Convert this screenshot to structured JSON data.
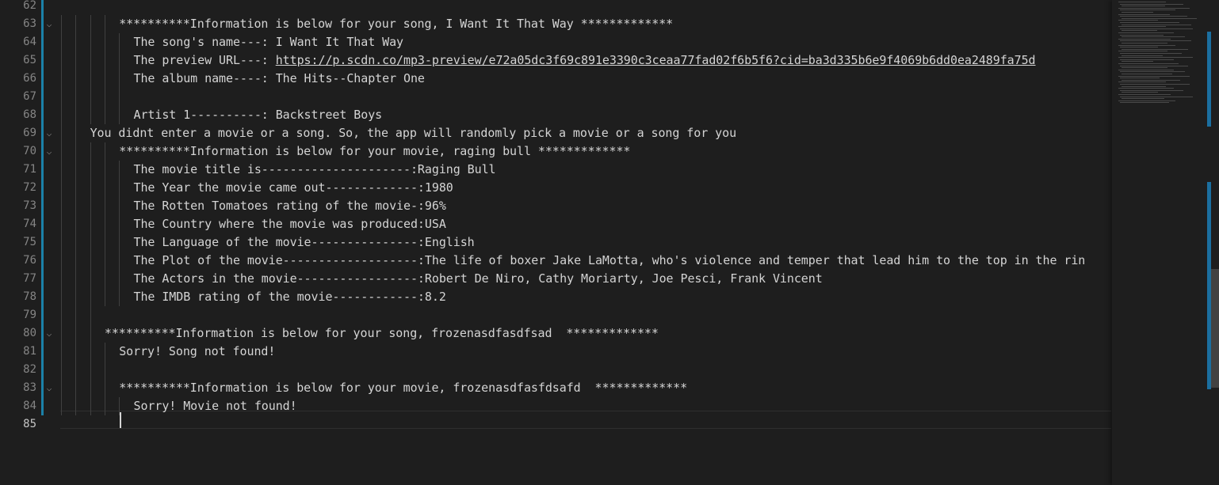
{
  "editor": {
    "lines": [
      {
        "num": "62",
        "text": "",
        "indent": 0,
        "fold": false,
        "modified": true
      },
      {
        "num": "63",
        "text": "**********Information is below for your song, I Want It That Way *************",
        "indent": 4,
        "fold": true,
        "modified": true
      },
      {
        "num": "64",
        "text": "The song's name---: I Want It That Way",
        "indent": 5,
        "fold": false,
        "modified": true
      },
      {
        "num": "65",
        "text": "The preview URL---: ",
        "link": "https://p.scdn.co/mp3-preview/e72a05dc3f69c891e3390c3ceaa77fad02f6b5f6?cid=ba3d335b6e9f4069b6dd0ea2489fa75d",
        "indent": 5,
        "fold": false,
        "modified": true
      },
      {
        "num": "66",
        "text": "The album name----: The Hits--Chapter One",
        "indent": 5,
        "fold": false,
        "modified": true
      },
      {
        "num": "67",
        "text": "",
        "indent": 0,
        "fold": false,
        "modified": true
      },
      {
        "num": "68",
        "text": "Artist 1----------: Backstreet Boys",
        "indent": 5,
        "fold": false,
        "modified": true
      },
      {
        "num": "69",
        "text": "You didnt enter a movie or a song. So, the app will randomly pick a movie or a song for you",
        "indent": 2,
        "fold": true,
        "modified": true
      },
      {
        "num": "70",
        "text": "**********Information is below for your movie, raging bull *************",
        "indent": 4,
        "fold": true,
        "modified": true
      },
      {
        "num": "71",
        "text": "The movie title is---------------------:Raging Bull",
        "indent": 5,
        "fold": false,
        "modified": true
      },
      {
        "num": "72",
        "text": "The Year the movie came out-------------:1980",
        "indent": 5,
        "fold": false,
        "modified": true
      },
      {
        "num": "73",
        "text": "The Rotten Tomatoes rating of the movie-:96%",
        "indent": 5,
        "fold": false,
        "modified": true
      },
      {
        "num": "74",
        "text": "The Country where the movie was produced:USA",
        "indent": 5,
        "fold": false,
        "modified": true
      },
      {
        "num": "75",
        "text": "The Language of the movie---------------:English",
        "indent": 5,
        "fold": false,
        "modified": true
      },
      {
        "num": "76",
        "text": "The Plot of the movie-------------------:The life of boxer Jake LaMotta, who's violence and temper that lead him to the top in the rin",
        "indent": 5,
        "fold": false,
        "modified": true
      },
      {
        "num": "77",
        "text": "The Actors in the movie-----------------:Robert De Niro, Cathy Moriarty, Joe Pesci, Frank Vincent",
        "indent": 5,
        "fold": false,
        "modified": true
      },
      {
        "num": "78",
        "text": "The IMDB rating of the movie------------:8.2",
        "indent": 5,
        "fold": false,
        "modified": true
      },
      {
        "num": "79",
        "text": "",
        "indent": 0,
        "fold": false,
        "modified": true
      },
      {
        "num": "80",
        "text": "**********Information is below for your song, frozenasdfasdfsad  *************",
        "indent": 3,
        "fold": true,
        "modified": true
      },
      {
        "num": "81",
        "text": "Sorry! Song not found!",
        "indent": 4,
        "fold": false,
        "modified": true
      },
      {
        "num": "82",
        "text": "",
        "indent": 0,
        "fold": false,
        "modified": true
      },
      {
        "num": "83",
        "text": "**********Information is below for your movie, frozenasdfasfdsafd  *************",
        "indent": 4,
        "fold": true,
        "modified": true
      },
      {
        "num": "84",
        "text": "Sorry! Movie not found!",
        "indent": 5,
        "fold": false,
        "modified": true
      },
      {
        "num": "85",
        "text": "",
        "indent": 0,
        "fold": false,
        "modified": false,
        "current": true
      }
    ]
  },
  "icons": {
    "fold": "chevron-down-icon"
  },
  "colors": {
    "background": "#1e1e1e",
    "text": "#d4d4d4",
    "line_number": "#858585",
    "modified_bar": "#1b81a8"
  }
}
